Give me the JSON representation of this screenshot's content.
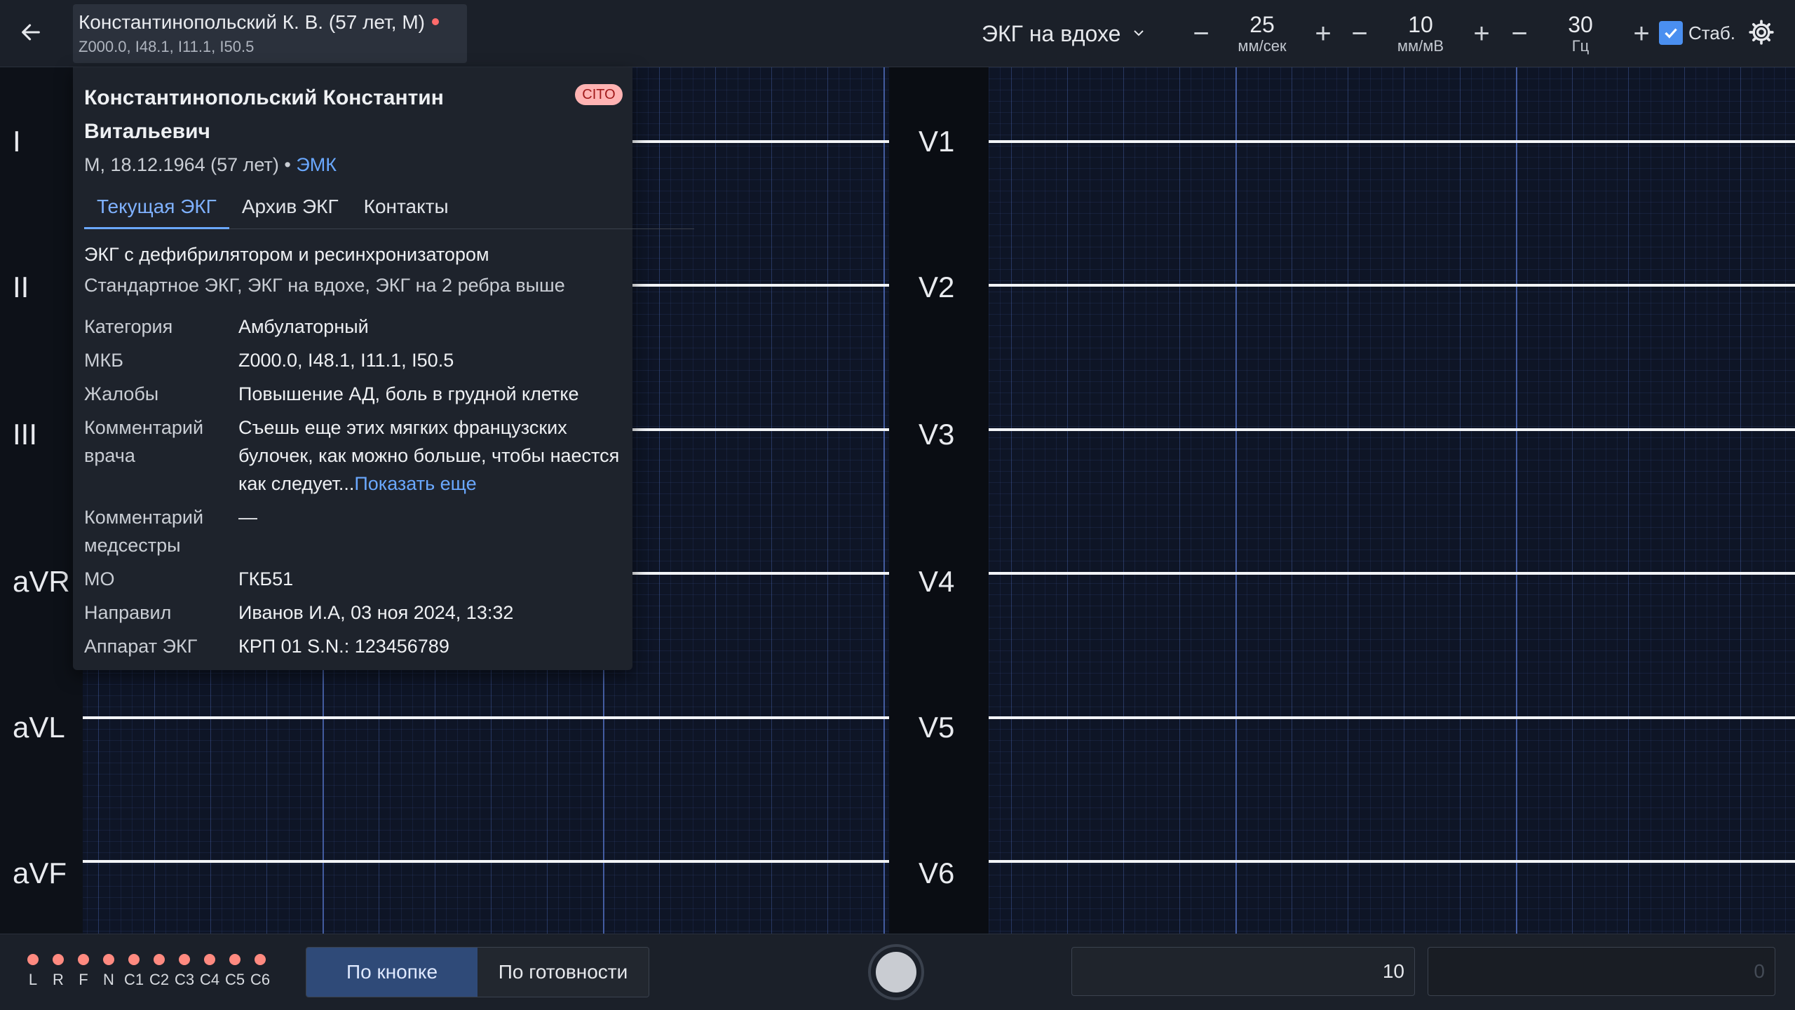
{
  "header": {
    "patient_short": "Константинопольский К. В. (57 лет, М)",
    "codes": "Z000.0, I48.1, I11.1, I50.5",
    "mode": "ЭКГ на вдохе",
    "speed": {
      "value": "25",
      "unit": "мм/сек",
      "minus": "−",
      "plus": "+"
    },
    "amplitude": {
      "value": "10",
      "unit": "мм/мВ",
      "minus": "−",
      "plus": "+"
    },
    "filter": {
      "value": "30",
      "unit": "Гц",
      "minus": "−",
      "plus": "+"
    },
    "stab_label": "Стаб."
  },
  "leads_left": [
    "I",
    "II",
    "III",
    "aVR",
    "aVL",
    "aVF"
  ],
  "leads_right": [
    "V1",
    "V2",
    "V3",
    "V4",
    "V5",
    "V6"
  ],
  "popover": {
    "full_name": "Константинопольский Константин Витальевич",
    "cito": "CITO",
    "sub": "М, 18.12.1964 (57 лет) •",
    "emk": "ЭМК",
    "tabs": [
      "Текущая ЭКГ",
      "Архив ЭКГ",
      "Контакты"
    ],
    "desc1": "ЭКГ с дефибрилятором и ресинхронизатором",
    "desc2": "Стандартное ЭКГ, ЭКГ на вдохе, ЭКГ на 2 ребра выше",
    "fields": [
      {
        "key": "Категория",
        "value": "Амбулаторный"
      },
      {
        "key": "МКБ",
        "value": "Z000.0, I48.1, I11.1, I50.5"
      },
      {
        "key": "Жалобы",
        "value": "Повышение АД, боль в грудной клетке"
      },
      {
        "key": "Комментарий врача",
        "value": "Съешь еще этих мягких французских булочек, как можно больше, чтобы наестся как следует...",
        "more": "Показать еще"
      },
      {
        "key": "Комментарий медсестры",
        "value": "—"
      },
      {
        "key": "МО",
        "value": "ГКБ51"
      },
      {
        "key": "Направил",
        "value": "Иванов И.А, 03 ноя 2024, 13:32"
      },
      {
        "key": "Аппарат ЭКГ",
        "value": "КРП 01 S.N.: 123456789"
      }
    ]
  },
  "footer": {
    "electrodes": [
      "L",
      "R",
      "F",
      "N",
      "C1",
      "C2",
      "C3",
      "C4",
      "C5",
      "C6"
    ],
    "electrode_color": "#ff8a80",
    "modes": [
      "По кнопке",
      "По готовности"
    ],
    "input1": "10",
    "input2": "0"
  },
  "colors": {
    "accent": "#6aa8ff",
    "cito_bg": "#ffb3b3",
    "grid": "#0e1526"
  }
}
